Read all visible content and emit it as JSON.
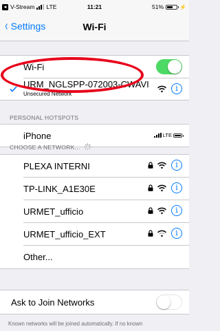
{
  "status_bar": {
    "carrier": "V-Stream",
    "network": "LTE",
    "time": "11:21",
    "battery": "51%"
  },
  "nav": {
    "back_label": "Settings",
    "title": "Wi-Fi"
  },
  "wifi_group": {
    "label": "Wi-Fi",
    "toggle": "on",
    "connected": {
      "name": "URM_NGLSPP-072003-CWAVI",
      "subtitle": "Unsecured Network"
    }
  },
  "hotspots": {
    "header": "PERSONAL HOTSPOTS",
    "items": [
      {
        "name": "iPhone",
        "network": "LTE"
      }
    ]
  },
  "choose": {
    "header": "CHOOSE A NETWORK...",
    "networks": [
      {
        "name": "PLEXA INTERNI"
      },
      {
        "name": "TP-LINK_A1E30E"
      },
      {
        "name": "URMET_ufficio"
      },
      {
        "name": "URMET_ufficio_EXT"
      }
    ],
    "other": "Other..."
  },
  "ask": {
    "label": "Ask to Join Networks",
    "toggle": "off",
    "footer": "Known networks will be joined automatically. If no known"
  },
  "colors": {
    "accent": "#007aff",
    "toggle_on": "#4cd964",
    "highlight": "#e8001a",
    "background": "#efeff4"
  },
  "icons": {
    "back": "chevron-left-icon",
    "wifi": "wifi-icon",
    "lock": "lock-icon",
    "info": "info-icon",
    "checkmark": "checkmark-icon",
    "spinner": "spinner-icon"
  }
}
